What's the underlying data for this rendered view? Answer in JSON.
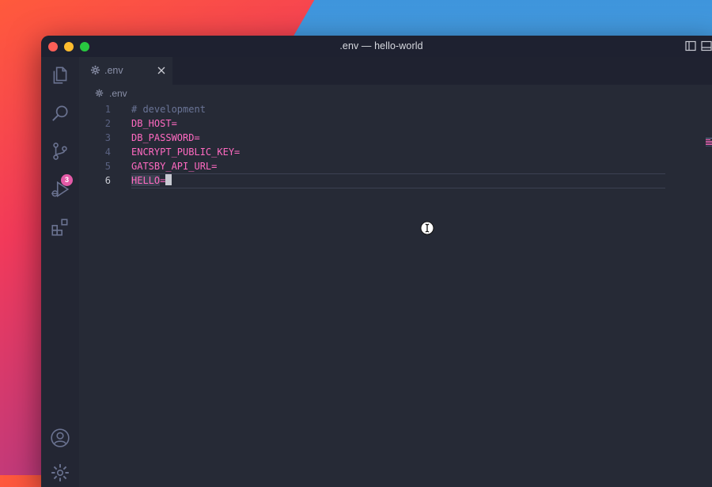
{
  "window": {
    "title": ".env — hello-world"
  },
  "activitybar": {
    "source_control_badge": "3"
  },
  "tab": {
    "label": ".env"
  },
  "breadcrumb": {
    "label": ".env"
  },
  "editor": {
    "lines": [
      {
        "number": "1",
        "text": "# development"
      },
      {
        "number": "2",
        "text": "DB_HOST="
      },
      {
        "number": "3",
        "text": "DB_PASSWORD="
      },
      {
        "number": "4",
        "text": "ENCRYPT_PUBLIC_KEY="
      },
      {
        "number": "5",
        "text": "GATSBY_API_URL="
      },
      {
        "number": "6",
        "text_selected": "HELLO",
        "text_rest": "="
      }
    ]
  },
  "colors": {
    "keyword": "#ff6ac1",
    "comment": "#6a7496",
    "badge": "#e35aa7"
  }
}
